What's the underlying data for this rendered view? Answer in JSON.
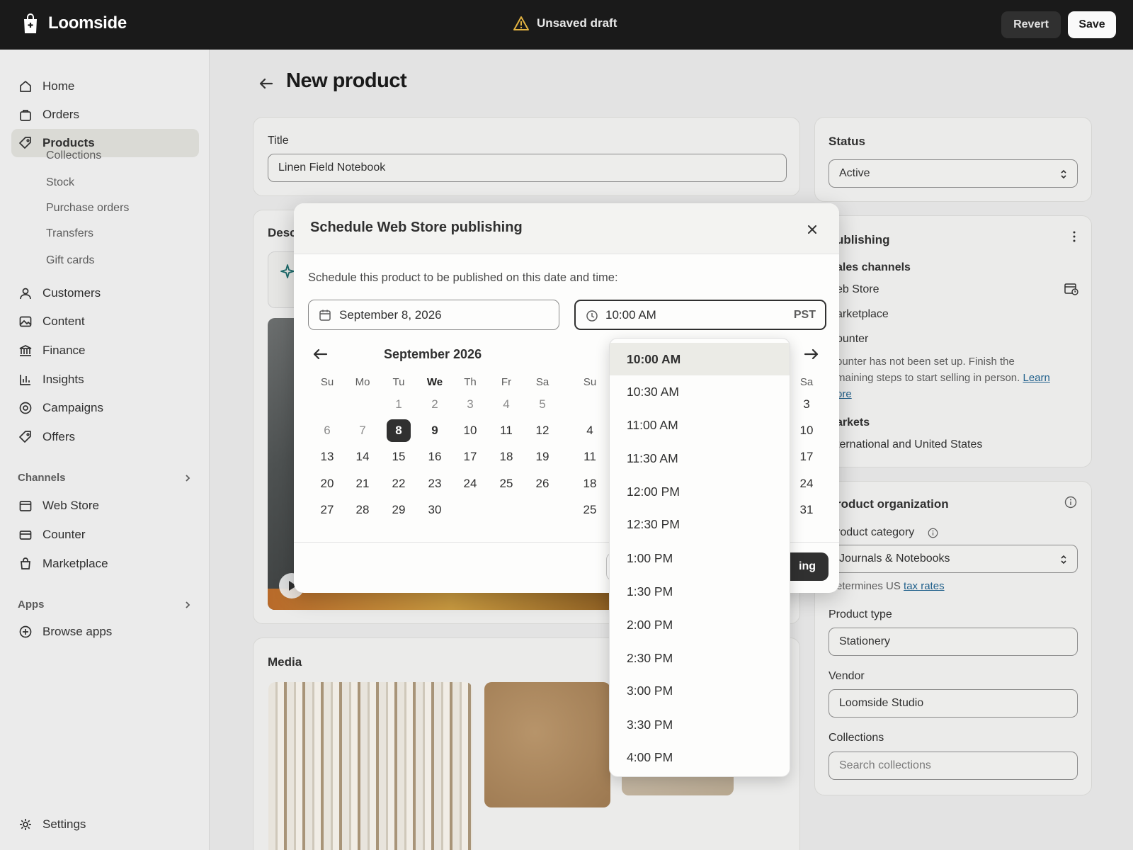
{
  "app": {
    "name": "Loomside",
    "draft_status": "Unsaved draft",
    "revert_label": "Revert",
    "save_label": "Save"
  },
  "sidebar": {
    "items": [
      {
        "label": "Home",
        "icon": "home-icon"
      },
      {
        "label": "Orders",
        "icon": "orders-icon"
      },
      {
        "label": "Products",
        "icon": "tag-icon",
        "active": true
      },
      {
        "label": "Customers",
        "icon": "person-icon"
      },
      {
        "label": "Content",
        "icon": "image-icon"
      },
      {
        "label": "Finance",
        "icon": "bank-icon"
      },
      {
        "label": "Insights",
        "icon": "bar-chart-icon"
      },
      {
        "label": "Campaigns",
        "icon": "target-icon"
      },
      {
        "label": "Offers",
        "icon": "discount-tag-icon"
      }
    ],
    "sub_items": [
      "Collections",
      "Stock",
      "Purchase orders",
      "Transfers",
      "Gift cards"
    ],
    "channels_heading": "Channels",
    "channels": [
      {
        "label": "Web Store",
        "icon": "store-icon"
      },
      {
        "label": "Counter",
        "icon": "card-icon"
      },
      {
        "label": "Marketplace",
        "icon": "bag-icon"
      }
    ],
    "apps_heading": "Apps",
    "apps": [
      {
        "label": "Browse apps",
        "icon": "plus-circle-icon"
      }
    ],
    "settings_label": "Settings"
  },
  "page": {
    "title": "New product"
  },
  "product": {
    "title_label": "Title",
    "title_value": "Linen Field Notebook",
    "description_label": "Desc",
    "media_label": "Media"
  },
  "status_card": {
    "label": "Status",
    "value": "Active"
  },
  "publishing_card": {
    "heading": "ublishing",
    "sales_channels_label": "ales channels",
    "channels": [
      "eb Store",
      "arketplace",
      "ounter"
    ],
    "counter_note_1": "ounter has not been set up. Finish the",
    "counter_note_2": "maining steps to start selling in person.",
    "learn_label": "Learn",
    "more_label": "ore",
    "markets_label": "arkets",
    "markets_value": "ternational and United States"
  },
  "organization_card": {
    "heading": "roduct organization",
    "category_label": "roduct category",
    "category_value": "Journals & Notebooks",
    "tax_note": "etermines US",
    "tax_link": "tax rates",
    "type_label": "Product type",
    "type_value": "Stationery",
    "vendor_label": "Vendor",
    "vendor_value": "Loomside Studio",
    "collections_label": "Collections",
    "collections_placeholder": "Search collections"
  },
  "modal": {
    "title": "Schedule Web Store publishing",
    "description": "Schedule this product to be published on this date and time:",
    "date_value": "September 8, 2026",
    "time_value": "10:00 AM",
    "timezone": "PST",
    "month_label": "September 2026",
    "dow": [
      "Su",
      "Mo",
      "Tu",
      "We",
      "Th",
      "Fr",
      "Sa"
    ],
    "weeks": [
      [
        "",
        "",
        "1",
        "2",
        "3",
        "4",
        "5"
      ],
      [
        "6",
        "7",
        "8",
        "9",
        "10",
        "11",
        "12"
      ],
      [
        "13",
        "14",
        "15",
        "16",
        "17",
        "18",
        "19"
      ],
      [
        "20",
        "21",
        "22",
        "23",
        "24",
        "25",
        "26"
      ],
      [
        "27",
        "28",
        "29",
        "30",
        "",
        "",
        ""
      ]
    ],
    "selected_day": "8",
    "today": "9",
    "second_month_dow_visible": [
      "Su",
      "Sa"
    ],
    "second_month_su": [
      "",
      "4",
      "11",
      "18",
      "25"
    ],
    "second_month_sa": [
      "3",
      "10",
      "17",
      "24",
      "31"
    ],
    "primary_button_partial": "ing"
  },
  "time_options": [
    "10:00 AM",
    "10:30 AM",
    "11:00 AM",
    "11:30 AM",
    "12:00 PM",
    "12:30 PM",
    "1:00 PM",
    "1:30 PM",
    "2:00 PM",
    "2:30 PM",
    "3:00 PM",
    "3:30 PM",
    "4:00 PM"
  ],
  "colors": {
    "topbar": "#1a1a1a",
    "selected_day": "#303030",
    "link": "#1f5f8b"
  }
}
